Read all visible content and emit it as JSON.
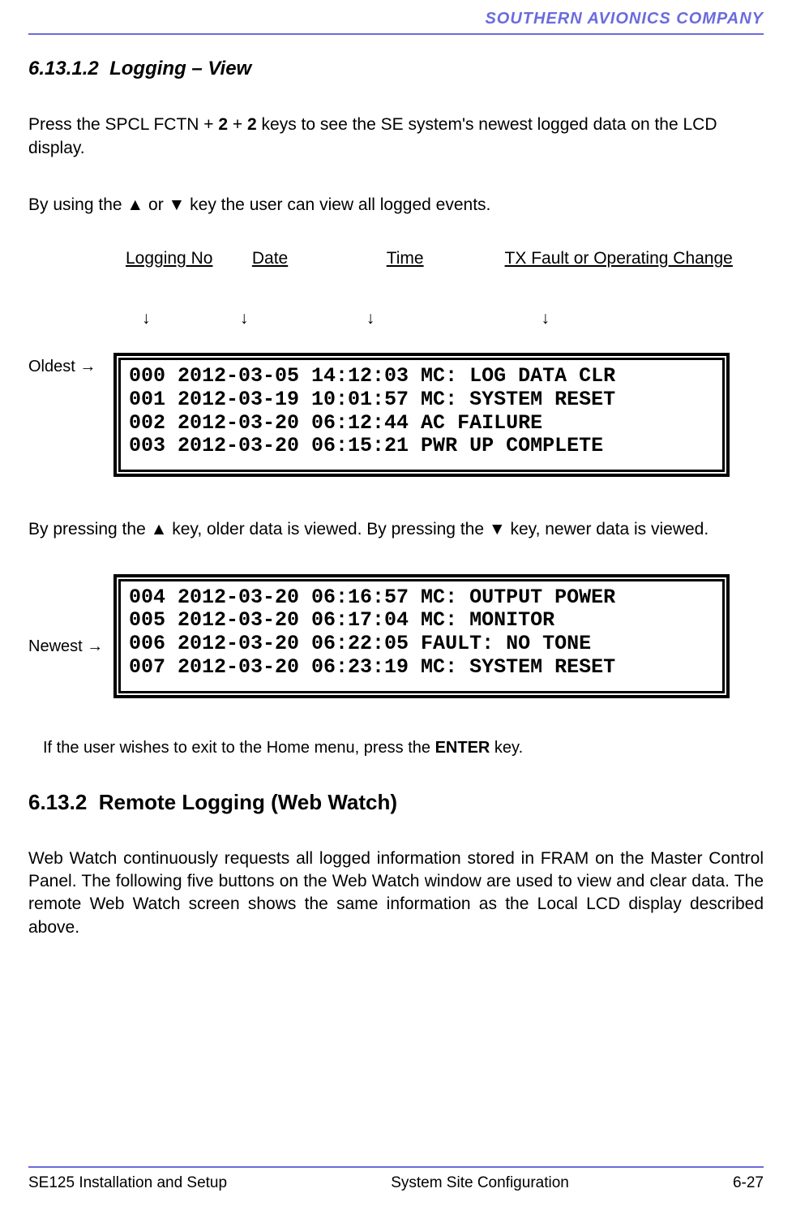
{
  "header": {
    "company": "SOUTHERN AVIONICS COMPANY"
  },
  "section1": {
    "number": "6.13.1.2",
    "title": "Logging – View",
    "para1_pre": "Press the SPCL FCTN + ",
    "para1_b1": "2",
    "para1_mid": " + ",
    "para1_b2": "2",
    "para1_post": " keys to see the SE system's newest logged data on the LCD display.",
    "para2": "By using the ▲ or ▼ key the user can view all logged events.",
    "columns": {
      "logno": "Logging No",
      "date": "Date",
      "time": "Time",
      "fault": "TX Fault or Operating Change"
    },
    "arrows": {
      "a1": "↓",
      "a2": "↓",
      "a3": "↓",
      "a4": "↓"
    },
    "oldest_label": "Oldest →",
    "lcd1": [
      "000 2012-03-05 14:12:03 MC: LOG DATA CLR",
      "001 2012-03-19 10:01:57 MC: SYSTEM RESET",
      "002 2012-03-20 06:12:44 AC FAILURE",
      "003 2012-03-20 06:15:21 PWR UP COMPLETE"
    ],
    "para3": "By pressing the ▲ key, older data is viewed. By pressing the ▼ key, newer data is viewed.",
    "newest_label": "Newest →",
    "lcd2": [
      "004 2012-03-20 06:16:57 MC: OUTPUT POWER",
      "005 2012-03-20 06:17:04 MC: MONITOR",
      "006 2012-03-20 06:22:05 FAULT: NO TONE",
      "007 2012-03-20 06:23:19 MC: SYSTEM RESET"
    ],
    "exit_pre": "If the user wishes to exit to the Home menu, press the ",
    "exit_bold": "ENTER",
    "exit_post": " key."
  },
  "section2": {
    "number": "6.13.2",
    "title": "Remote Logging (Web Watch)",
    "para": "Web Watch continuously requests all logged information stored in FRAM on the Master Control Panel. The following five buttons on the Web Watch window are used to view and clear data. The remote Web Watch screen shows the same information as the Local LCD display described above."
  },
  "footer": {
    "left": "SE125 Installation and Setup",
    "center": "System Site Configuration",
    "right": "6-27"
  }
}
